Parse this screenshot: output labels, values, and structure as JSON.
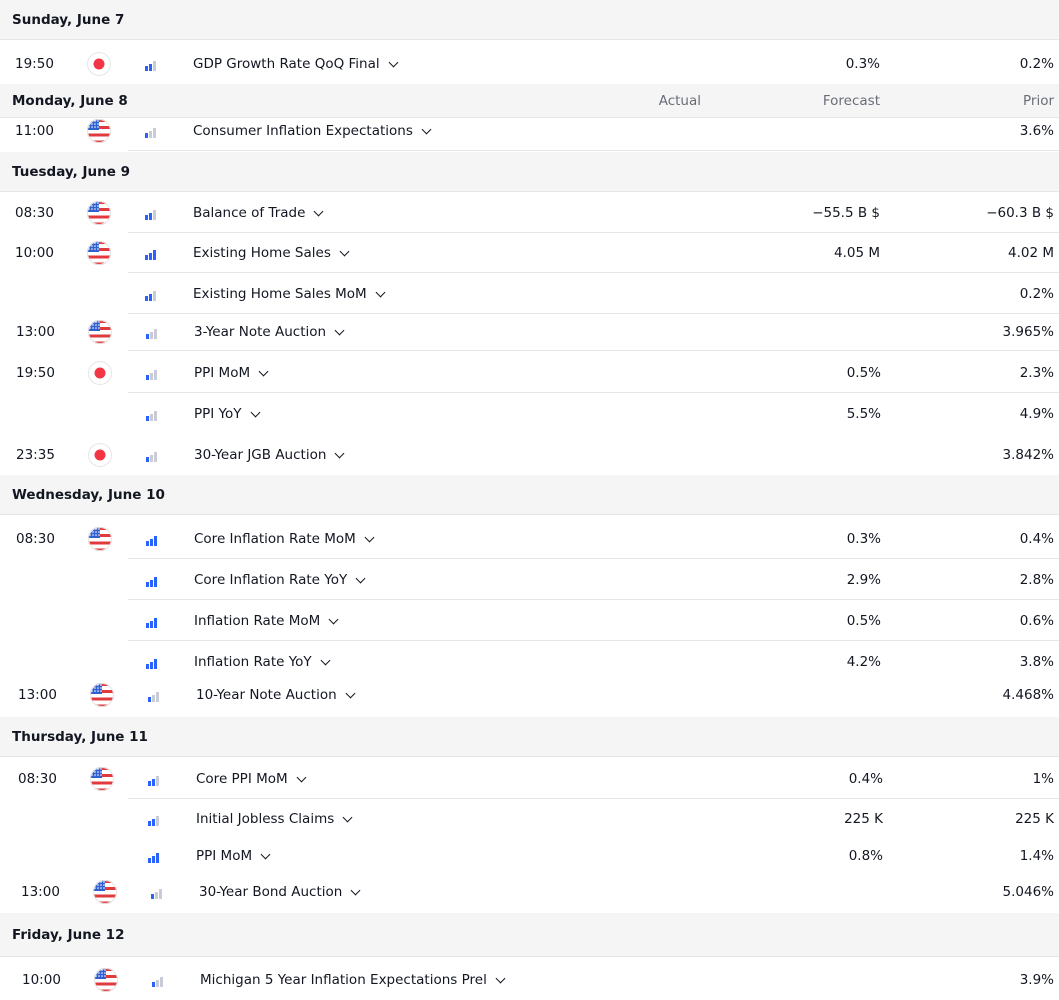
{
  "columns": {
    "actual": "Actual",
    "forecast": "Forecast",
    "prior": "Prior"
  },
  "colors": {
    "us_red": "#e03a3e",
    "us_blue": "#2f5fd0",
    "jp_red": "#f23645",
    "bar_active": "#2962ff",
    "bar_inactive": "#c9ccd6"
  },
  "days": [
    {
      "label": "Sunday, June 7",
      "show_headers": false,
      "events": [
        {
          "time": "19:50",
          "country": "jp-flag-icon",
          "importance": 2,
          "name": "GDP Growth Rate QoQ Final",
          "actual": "",
          "forecast": "0.3%",
          "prior": "0.2%"
        }
      ]
    },
    {
      "label": "Monday, June 8",
      "show_headers": true,
      "events": [
        {
          "time": "11:00",
          "country": "us-flag-icon",
          "importance": 1,
          "name": "Consumer Inflation Expectations",
          "actual": "",
          "forecast": "",
          "prior": "3.6%"
        }
      ]
    },
    {
      "label": "Tuesday, June 9",
      "show_headers": false,
      "events": [
        {
          "time": "08:30",
          "country": "us-flag-icon",
          "importance": 2,
          "name": "Balance of Trade",
          "actual": "",
          "forecast": "−55.5 B $",
          "prior": "−60.3 B $"
        },
        {
          "time": "10:00",
          "country": "us-flag-icon",
          "importance": 3,
          "name": "Existing Home Sales",
          "actual": "",
          "forecast": "4.05 M",
          "prior": "4.02 M"
        },
        {
          "time": "",
          "country": "",
          "importance": 2,
          "name": "Existing Home Sales MoM",
          "actual": "",
          "forecast": "",
          "prior": "0.2%"
        },
        {
          "time": "13:00",
          "country": "us-flag-icon",
          "importance": 1,
          "name": "3-Year Note Auction",
          "actual": "",
          "forecast": "",
          "prior": "3.965%"
        },
        {
          "time": "19:50",
          "country": "jp-flag-icon",
          "importance": 1,
          "name": "PPI MoM",
          "actual": "",
          "forecast": "0.5%",
          "prior": "2.3%"
        },
        {
          "time": "",
          "country": "",
          "importance": 1,
          "name": "PPI YoY",
          "actual": "",
          "forecast": "5.5%",
          "prior": "4.9%"
        },
        {
          "time": "23:35",
          "country": "jp-flag-icon",
          "importance": 1,
          "name": "30-Year JGB Auction",
          "actual": "",
          "forecast": "",
          "prior": "3.842%"
        }
      ]
    },
    {
      "label": "Wednesday, June 10",
      "show_headers": false,
      "events": [
        {
          "time": "08:30",
          "country": "us-flag-icon",
          "importance": 3,
          "name": "Core Inflation Rate MoM",
          "actual": "",
          "forecast": "0.3%",
          "prior": "0.4%"
        },
        {
          "time": "",
          "country": "",
          "importance": 3,
          "name": "Core Inflation Rate YoY",
          "actual": "",
          "forecast": "2.9%",
          "prior": "2.8%"
        },
        {
          "time": "",
          "country": "",
          "importance": 3,
          "name": "Inflation Rate MoM",
          "actual": "",
          "forecast": "0.5%",
          "prior": "0.6%"
        },
        {
          "time": "",
          "country": "",
          "importance": 3,
          "name": "Inflation Rate YoY",
          "actual": "",
          "forecast": "4.2%",
          "prior": "3.8%"
        },
        {
          "time": "13:00",
          "country": "us-flag-icon",
          "importance": 1,
          "name": "10-Year Note Auction",
          "actual": "",
          "forecast": "",
          "prior": "4.468%"
        }
      ]
    },
    {
      "label": "Thursday, June 11",
      "show_headers": false,
      "events": [
        {
          "time": "08:30",
          "country": "us-flag-icon",
          "importance": 2,
          "name": "Core PPI MoM",
          "actual": "",
          "forecast": "0.4%",
          "prior": "1%"
        },
        {
          "time": "",
          "country": "",
          "importance": 2,
          "name": "Initial Jobless Claims",
          "actual": "",
          "forecast": "225 K",
          "prior": "225 K"
        },
        {
          "time": "",
          "country": "",
          "importance": 3,
          "name": "PPI MoM",
          "actual": "",
          "forecast": "0.8%",
          "prior": "1.4%"
        },
        {
          "time": "13:00",
          "country": "us-flag-icon",
          "importance": 1,
          "name": "30-Year Bond Auction",
          "actual": "",
          "forecast": "",
          "prior": "5.046%"
        }
      ]
    },
    {
      "label": "Friday, June 12",
      "show_headers": false,
      "events": [
        {
          "time": "10:00",
          "country": "us-flag-icon",
          "importance": 1,
          "name": "Michigan 5 Year Inflation Expectations Prel",
          "actual": "",
          "forecast": "",
          "prior": "3.9%"
        }
      ]
    }
  ]
}
